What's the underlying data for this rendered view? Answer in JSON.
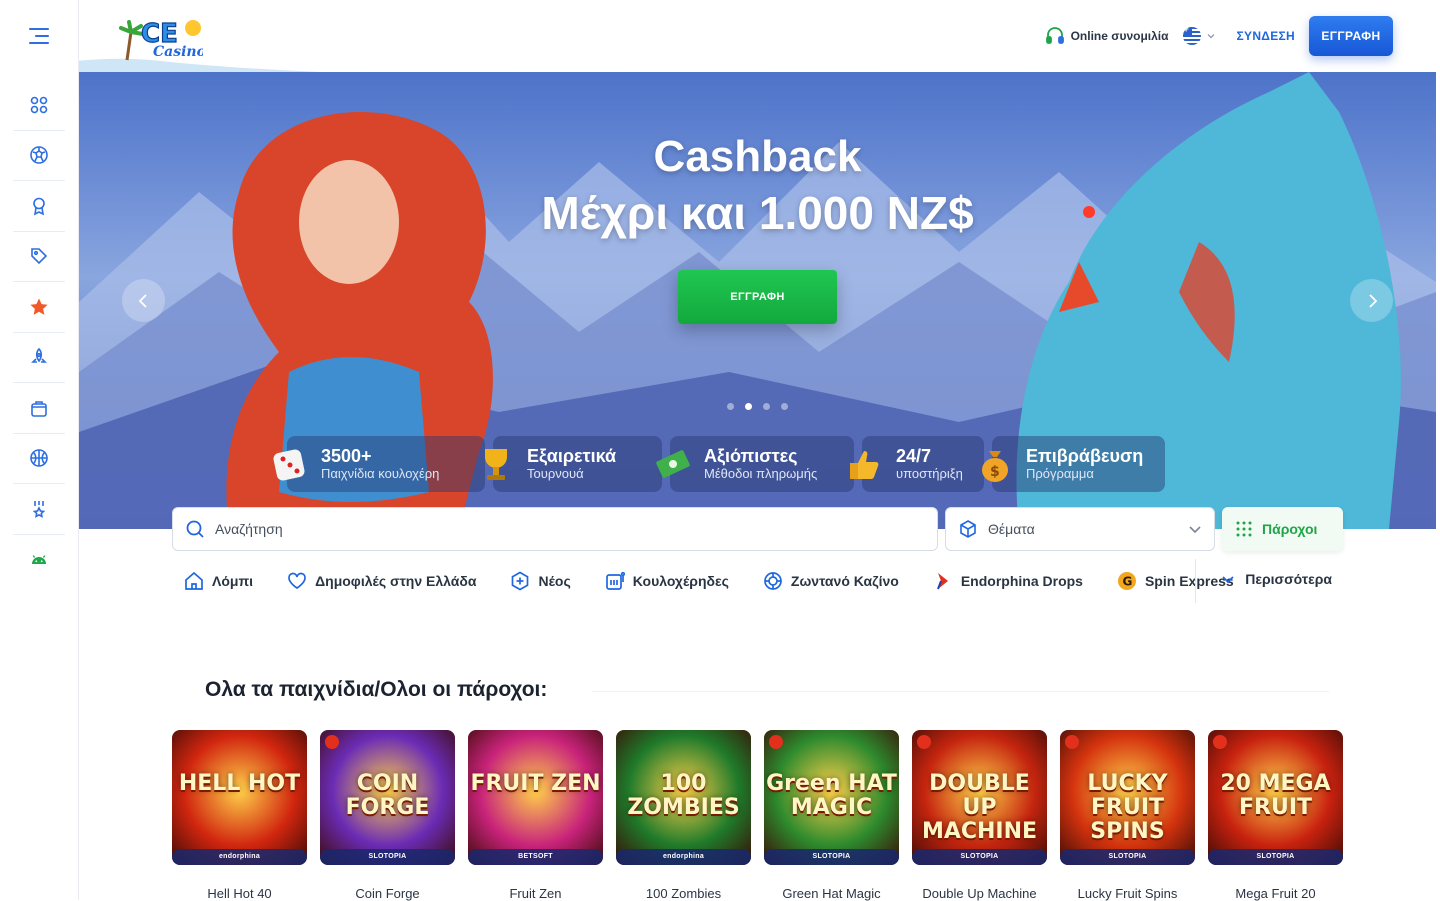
{
  "header": {
    "logo_text": "ICE Casino",
    "chat_label": "Online συνομιλία",
    "login_label": "ΣΥΝΔΕΣΗ",
    "signup_label": "ΕΓΓΡΑΦΗ"
  },
  "sidebar": {
    "items": [
      "grid-icon",
      "soccer-ball-icon",
      "award-icon",
      "tag-icon",
      "star-icon",
      "rocket-icon",
      "shopping-bag-icon",
      "basketball-icon",
      "trophy-icon",
      "android-icon"
    ]
  },
  "hero": {
    "title_line1": "Cashback",
    "title_line2": "Μέχρι και 1.000 NZ$",
    "cta_label": "ΕΓΓΡΑΦΗ",
    "active_slide": 2,
    "slide_count": 4,
    "features": [
      {
        "title": "3500+",
        "subtitle": "Παιχνίδια κουλοχέρη",
        "icon": "dice-icon"
      },
      {
        "title": "Εξαιρετικά",
        "subtitle": "Τουρνουά",
        "icon": "trophy-icon"
      },
      {
        "title": "Αξιόπιστες",
        "subtitle": "Μέθοδοι πληρωμής",
        "icon": "money-icon"
      },
      {
        "title": "24/7",
        "subtitle": "υποστήριξη",
        "icon": "thumbs-up-icon"
      },
      {
        "title": "Επιβράβευση",
        "subtitle": "Πρόγραμμα",
        "icon": "money-bag-icon"
      }
    ]
  },
  "search": {
    "placeholder": "Αναζήτηση",
    "themes_label": "Θέματα",
    "providers_label": "Πάροχοι"
  },
  "categories": {
    "items": [
      {
        "label": "Λόμπι",
        "icon": "home-icon"
      },
      {
        "label": "Δημοφιλές στην Ελλάδα",
        "icon": "heart-icon"
      },
      {
        "label": "Νέος",
        "icon": "plus-badge-icon"
      },
      {
        "label": "Κουλοχέρηδες",
        "icon": "slot-machine-icon"
      },
      {
        "label": "Ζωντανό Καζίνο",
        "icon": "chip-icon"
      },
      {
        "label": "Endorphina Drops",
        "icon": "endorphina-icon"
      },
      {
        "label": "Spin Express",
        "icon": "g-coin-icon"
      }
    ],
    "more_label": "Περισσότερα"
  },
  "section": {
    "title": "Ολα τα παιχνίδια/Ολοι οι πάροχοι:"
  },
  "games": [
    {
      "title": "Hell Hot 40",
      "art": "HELL HOT",
      "provider": "endorphina",
      "bg": "#d1260f",
      "hot": false
    },
    {
      "title": "Coin Forge",
      "art": "COIN FORGE",
      "provider": "SLOTOPIA",
      "bg": "#6b2bb5",
      "hot": true
    },
    {
      "title": "Fruit Zen",
      "art": "FRUIT ZEN",
      "provider": "BETSOFT",
      "bg": "#c8237a",
      "hot": false
    },
    {
      "title": "100 Zombies",
      "art": "100 ZOMBIES",
      "provider": "endorphina",
      "bg": "#1f7a2a",
      "hot": false
    },
    {
      "title": "Green Hat Magic",
      "art": "Green HAT MAGIC",
      "provider": "SLOTOPIA",
      "bg": "#2d8a2d",
      "hot": true
    },
    {
      "title": "Double Up Machine",
      "art": "DOUBLE UP MACHINE",
      "provider": "SLOTOPIA",
      "bg": "#c5250f",
      "hot": true
    },
    {
      "title": "Lucky Fruit Spins",
      "art": "LUCKY FRUIT SPINS",
      "provider": "SLOTOPIA",
      "bg": "#d4330e",
      "hot": true
    },
    {
      "title": "Mega Fruit 20",
      "art": "20 MEGA FRUIT",
      "provider": "SLOTOPIA",
      "bg": "#c8220f",
      "hot": true
    }
  ],
  "colors": {
    "accent_blue": "#1f67e0",
    "cta_green": "#1bb84a",
    "providers_green": "#1fa548"
  }
}
